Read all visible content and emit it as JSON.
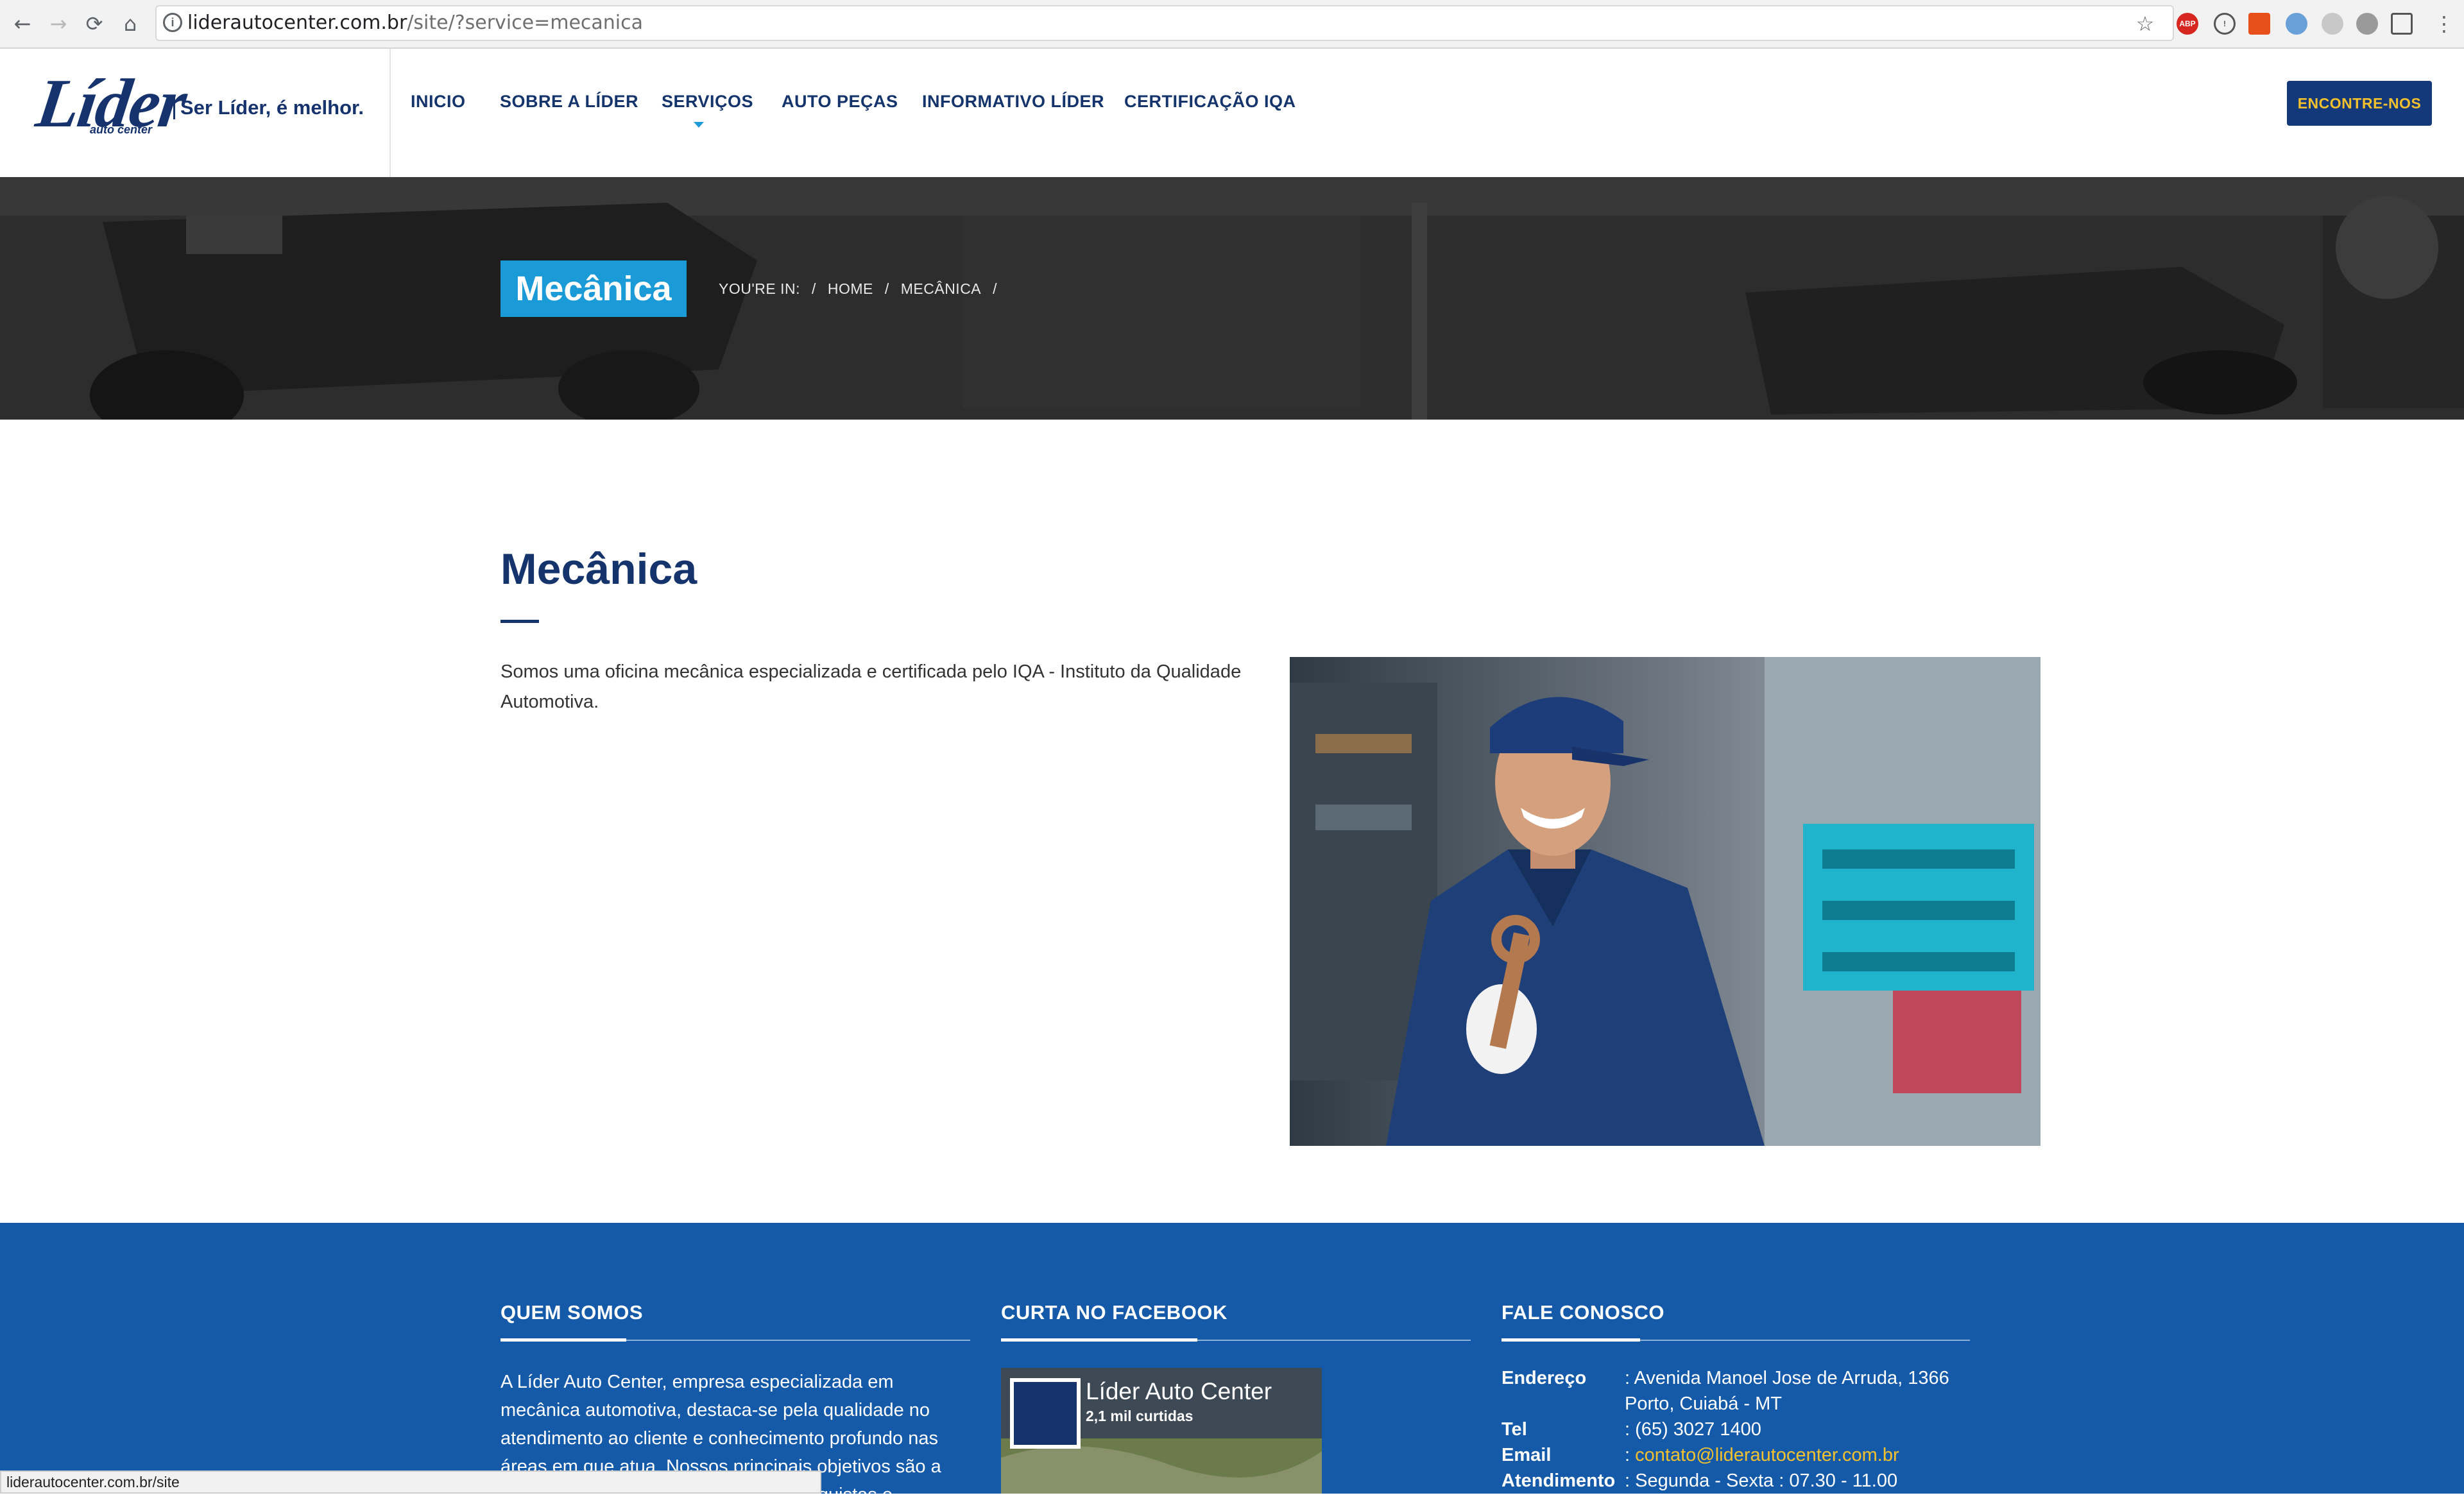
{
  "browser": {
    "url_host": "liderautocenter.com.br",
    "url_path": "/site/?service=mecanica",
    "status_url": "liderautocenter.com.br/site"
  },
  "header": {
    "logo_text": "Líder",
    "logo_sub": "auto center",
    "tagline": "Ser Líder, é melhor.",
    "menu": [
      {
        "label": "INICIO"
      },
      {
        "label": "SOBRE A LÍDER"
      },
      {
        "label": "SERVIÇOS"
      },
      {
        "label": "AUTO PEÇAS"
      },
      {
        "label": "INFORMATIVO LÍDER"
      },
      {
        "label": "CERTIFICAÇÃO IQA"
      }
    ],
    "cta_label": "ENCONTRE-NOS"
  },
  "hero": {
    "title": "Mecânica",
    "breadcrumb": {
      "prefix": "YOU'RE IN:",
      "home": "HOME",
      "current": "MECÂNICA"
    }
  },
  "main": {
    "title": "Mecânica",
    "intro": "Somos uma oficina mecânica especializada e certificada pelo IQA - Instituto da Qualidade Automotiva."
  },
  "footer": {
    "about": {
      "heading": "QUEM SOMOS",
      "text": "A Líder Auto Center, empresa especializada em mecânica automotiva, destaca-se pela qualidade no atendimento ao cliente e conhecimento profundo nas áreas em que atua. Nossos principais objetivos são a satisfação de nossos clientes e as conquistas e"
    },
    "facebook": {
      "heading": "CURTA NO FACEBOOK",
      "page_name": "Líder Auto Center",
      "likes": "2,1 mil curtidas"
    },
    "contact": {
      "heading": "FALE CONOSCO",
      "rows": [
        {
          "label": "Endereço",
          "value": ": Avenida Manoel Jose de Arruda, 1366"
        },
        {
          "label": "",
          "value": "Porto, Cuiabá - MT"
        },
        {
          "label": "Tel",
          "value": ": (65) 3027 1400"
        },
        {
          "label": "Email",
          "value": ": ",
          "link": "contato@liderautocenter.com.br"
        },
        {
          "label": "Atendimento",
          "value": ": Segunda - Sexta : 07.30 - 11.00"
        }
      ]
    }
  },
  "colors": {
    "brand_navy": "#14346b",
    "accent_blue": "#1a9ad7",
    "footer_blue": "#1559a9",
    "cta_text": "#f4c12e"
  }
}
